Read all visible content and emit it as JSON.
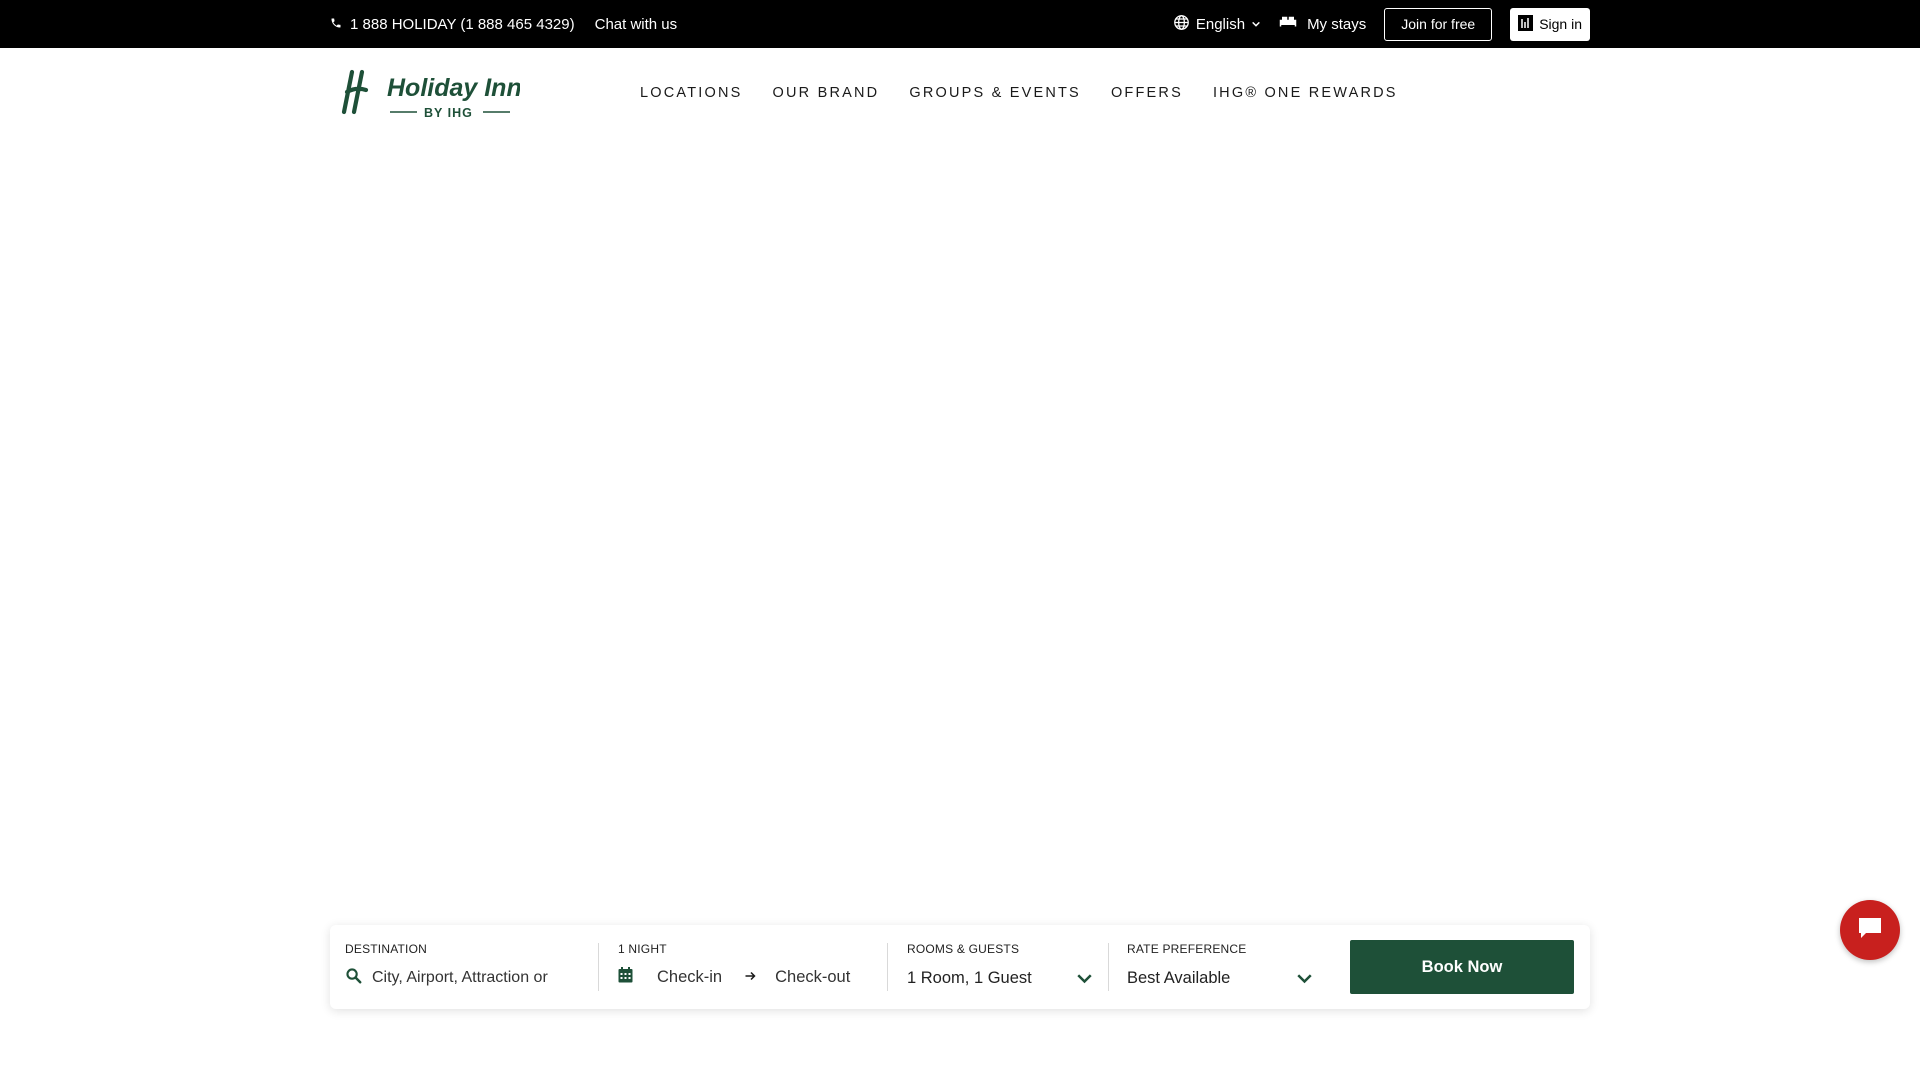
{
  "topbar": {
    "phone": "1 888 HOLIDAY (1 888 465 4329)",
    "chat": "Chat with us",
    "language": "English",
    "my_stays": "My stays",
    "join": "Join for free",
    "sign_in": "Sign in"
  },
  "brand": {
    "name": "Holiday Inn",
    "sub": "BY IHG",
    "color": "#1e5038"
  },
  "nav": {
    "items": [
      {
        "label": "LOCATIONS"
      },
      {
        "label": "OUR BRAND"
      },
      {
        "label": "GROUPS & EVENTS"
      },
      {
        "label": "OFFERS"
      },
      {
        "label": "IHG® ONE REWARDS"
      }
    ]
  },
  "booking": {
    "destination_label": "DESTINATION",
    "destination_placeholder": "City, Airport, Attraction or",
    "nights_label": "1 NIGHT",
    "checkin": "Check-in",
    "checkout": "Check-out",
    "rooms_label": "ROOMS & GUESTS",
    "rooms_value": "1 Room, 1 Guest",
    "rate_label": "RATE PREFERENCE",
    "rate_value": "Best Available",
    "book_now": "Book Now"
  },
  "colors": {
    "topbar_bg": "#000000",
    "accent_green": "#1e5038",
    "chat_red": "#c8201e"
  }
}
